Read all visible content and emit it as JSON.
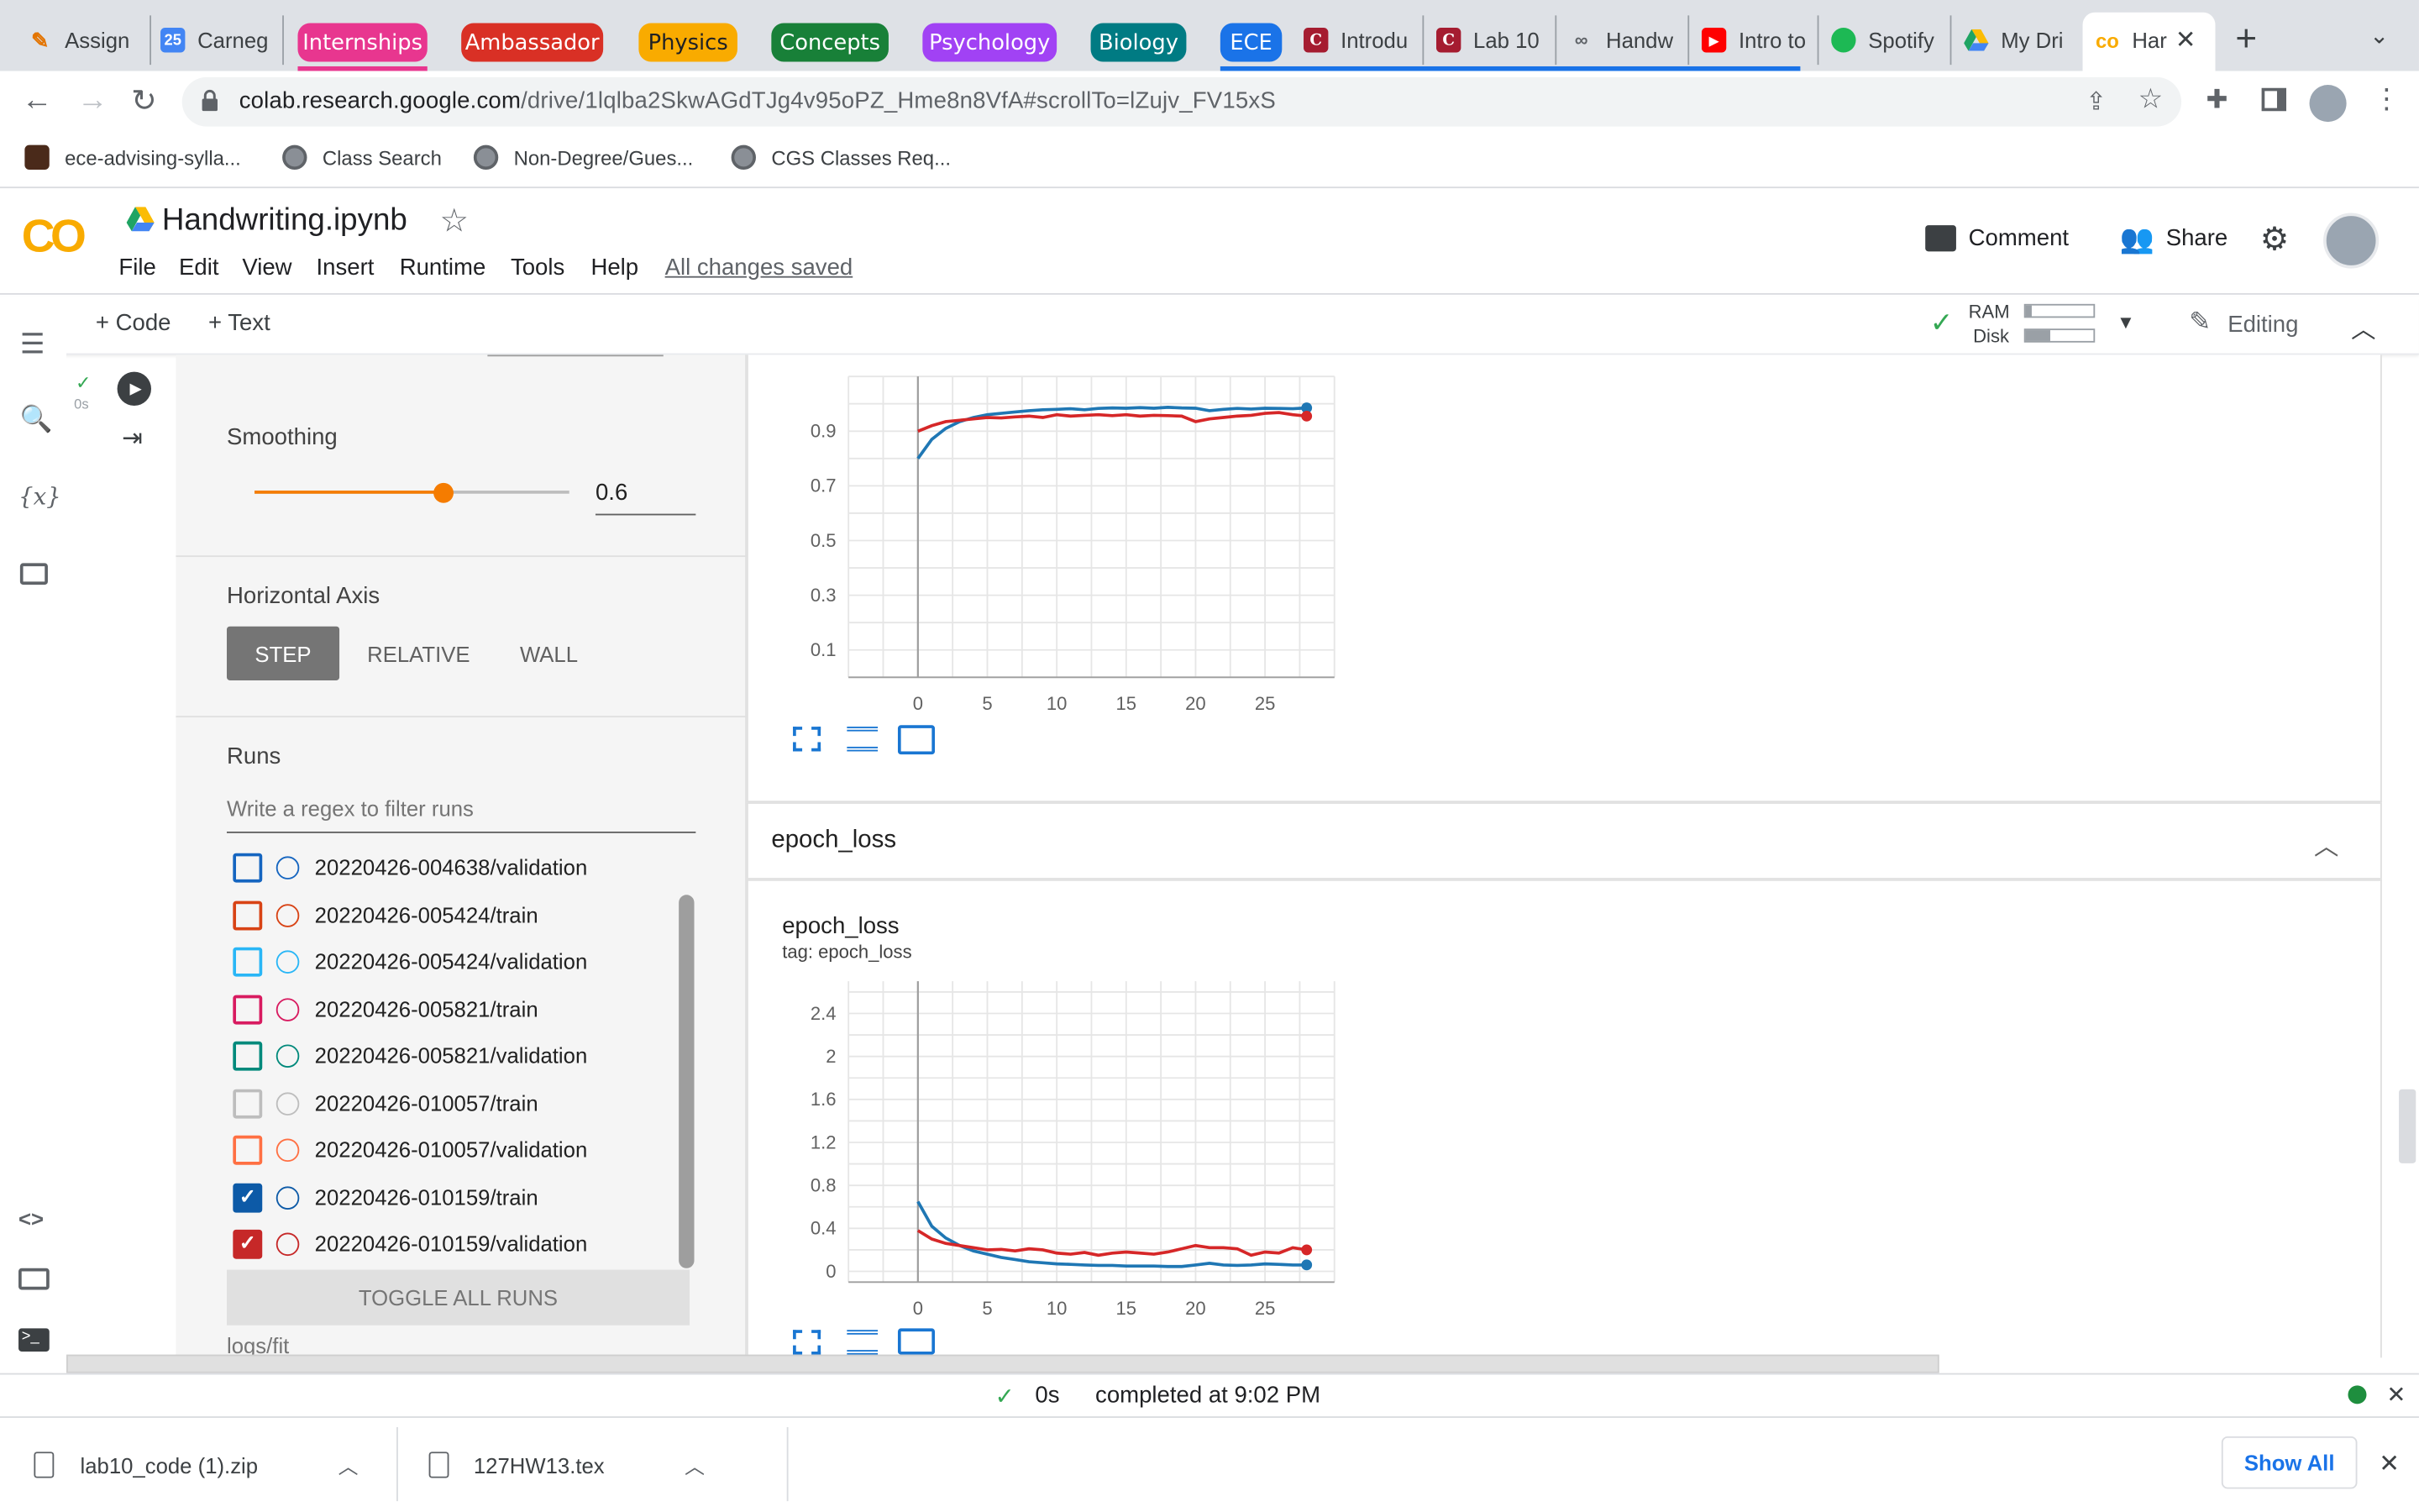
{
  "tabs": {
    "t1": "Assign",
    "t2": "Carneg",
    "t2_badge": "25",
    "g1": "Internships",
    "g2": "Ambassador",
    "g3": "Physics",
    "g4": "Concepts",
    "g5": "Psychology",
    "g6": "Biology",
    "g7": "ECE",
    "t3": "Introdu",
    "t4": "Lab 10",
    "t5": "Handw",
    "t6": "Intro to",
    "t7": "Spotify",
    "t8": "My Dri",
    "active": "Har",
    "group_colors": {
      "Internships": "#e8368f",
      "Ambassador": "#d93025",
      "Physics": "#f9ab00",
      "Concepts": "#188038",
      "Psychology": "#a142f4",
      "Biology": "#007b83",
      "ECE": "#1a73e8"
    }
  },
  "address": {
    "host": "colab.research.google.com",
    "path": "/drive/1lqlba2SkwAGdTJg4v95oPZ_Hme8n8VfA#scrollTo=lZujv_FV15xS"
  },
  "bookmarks": [
    "ece-advising-sylla...",
    "Class Search",
    "Non-Degree/Gues...",
    "CGS Classes Req..."
  ],
  "colab": {
    "logo": "CO",
    "notebook_title": "Handwriting.ipynb",
    "menu": [
      "File",
      "Edit",
      "View",
      "Insert",
      "Runtime",
      "Tools",
      "Help"
    ],
    "saved_status": "All changes saved",
    "comment": "Comment",
    "share": "Share",
    "add_code": "+ Code",
    "add_text": "+ Text",
    "ram": "RAM",
    "disk": "Disk",
    "editing": "Editing",
    "cell_time": "0s"
  },
  "settings": {
    "smoothing_label": "Smoothing",
    "smoothing_value": "0.6",
    "smoothing_fraction": 0.6,
    "axis_label": "Horizontal Axis",
    "axis_options": [
      "STEP",
      "RELATIVE",
      "WALL"
    ],
    "axis_selected": "STEP",
    "runs_label": "Runs",
    "filter_placeholder": "Write a regex to filter runs",
    "runs": [
      {
        "name": "20220426-004638/validation",
        "color": "#1565c0",
        "checked": false
      },
      {
        "name": "20220426-005424/train",
        "color": "#d84315",
        "checked": false
      },
      {
        "name": "20220426-005424/validation",
        "color": "#29b6f6",
        "checked": false
      },
      {
        "name": "20220426-005821/train",
        "color": "#d81b60",
        "checked": false
      },
      {
        "name": "20220426-005821/validation",
        "color": "#00897b",
        "checked": false
      },
      {
        "name": "20220426-010057/train",
        "color": "#bdbdbd",
        "checked": false
      },
      {
        "name": "20220426-010057/validation",
        "color": "#ff7043",
        "checked": false
      },
      {
        "name": "20220426-010159/train",
        "color": "#0d5aa7",
        "checked": true
      },
      {
        "name": "20220426-010159/validation",
        "color": "#c62828",
        "checked": true
      }
    ],
    "toggle_all": "TOGGLE ALL RUNS",
    "logdir": "logs/fit"
  },
  "section": {
    "epoch_loss_header": "epoch_loss",
    "epoch_loss_title": "epoch_loss",
    "epoch_loss_tag": "tag: epoch_loss"
  },
  "chart_data": [
    {
      "type": "line",
      "title": "",
      "xlabel": "",
      "ylabel": "",
      "x_ticks": [
        "0",
        "5",
        "10",
        "15",
        "20",
        "25"
      ],
      "y_ticks": [
        "0.1",
        "0.3",
        "0.5",
        "0.7",
        "0.9"
      ],
      "xlim": [
        -5,
        30
      ],
      "ylim": [
        0,
        1.1
      ],
      "grid": true,
      "series": [
        {
          "color": "#1f77b4",
          "x": [
            0,
            1,
            2,
            3,
            4,
            5,
            6,
            7,
            8,
            9,
            10,
            11,
            12,
            13,
            14,
            15,
            16,
            17,
            18,
            19,
            20,
            21,
            22,
            23,
            24,
            25,
            26,
            27,
            28
          ],
          "y": [
            0.8,
            0.87,
            0.91,
            0.935,
            0.95,
            0.96,
            0.965,
            0.97,
            0.975,
            0.978,
            0.98,
            0.982,
            0.978,
            0.983,
            0.985,
            0.984,
            0.986,
            0.984,
            0.987,
            0.985,
            0.984,
            0.975,
            0.98,
            0.983,
            0.981,
            0.984,
            0.983,
            0.982,
            0.985
          ]
        },
        {
          "color": "#d62728",
          "x": [
            0,
            1,
            2,
            3,
            4,
            5,
            6,
            7,
            8,
            9,
            10,
            11,
            12,
            13,
            14,
            15,
            16,
            17,
            18,
            19,
            20,
            21,
            22,
            23,
            24,
            25,
            26,
            27,
            28
          ],
          "y": [
            0.9,
            0.92,
            0.935,
            0.94,
            0.945,
            0.95,
            0.948,
            0.952,
            0.955,
            0.95,
            0.96,
            0.955,
            0.958,
            0.96,
            0.957,
            0.96,
            0.955,
            0.958,
            0.957,
            0.955,
            0.935,
            0.945,
            0.95,
            0.955,
            0.958,
            0.965,
            0.968,
            0.96,
            0.955
          ]
        }
      ]
    },
    {
      "type": "line",
      "title": "epoch_loss",
      "xlabel": "",
      "ylabel": "",
      "x_ticks": [
        "0",
        "5",
        "10",
        "15",
        "20",
        "25"
      ],
      "y_ticks": [
        "0",
        "0.4",
        "0.8",
        "1.2",
        "1.6",
        "2",
        "2.4"
      ],
      "xlim": [
        -5,
        30
      ],
      "ylim": [
        -0.1,
        2.7
      ],
      "grid": true,
      "series": [
        {
          "color": "#1f77b4",
          "x": [
            0,
            1,
            2,
            3,
            4,
            5,
            6,
            7,
            8,
            9,
            10,
            11,
            12,
            13,
            14,
            15,
            16,
            17,
            18,
            19,
            20,
            21,
            22,
            23,
            24,
            25,
            26,
            27,
            28
          ],
          "y": [
            0.65,
            0.42,
            0.31,
            0.24,
            0.19,
            0.16,
            0.13,
            0.11,
            0.09,
            0.08,
            0.07,
            0.065,
            0.06,
            0.055,
            0.055,
            0.05,
            0.05,
            0.05,
            0.045,
            0.045,
            0.06,
            0.075,
            0.06,
            0.055,
            0.06,
            0.07,
            0.065,
            0.06,
            0.06
          ]
        },
        {
          "color": "#d62728",
          "x": [
            0,
            1,
            2,
            3,
            4,
            5,
            6,
            7,
            8,
            9,
            10,
            11,
            12,
            13,
            14,
            15,
            16,
            17,
            18,
            19,
            20,
            21,
            22,
            23,
            24,
            25,
            26,
            27,
            28
          ],
          "y": [
            0.38,
            0.3,
            0.26,
            0.24,
            0.22,
            0.2,
            0.205,
            0.19,
            0.21,
            0.2,
            0.17,
            0.16,
            0.175,
            0.15,
            0.17,
            0.18,
            0.17,
            0.16,
            0.18,
            0.21,
            0.24,
            0.22,
            0.22,
            0.21,
            0.15,
            0.18,
            0.17,
            0.22,
            0.2
          ]
        }
      ]
    }
  ],
  "status": {
    "time": "0s",
    "message": "completed at 9:02 PM"
  },
  "downloads": {
    "items": [
      "lab10_code (1).zip",
      "127HW13.tex"
    ],
    "show_all": "Show All"
  }
}
